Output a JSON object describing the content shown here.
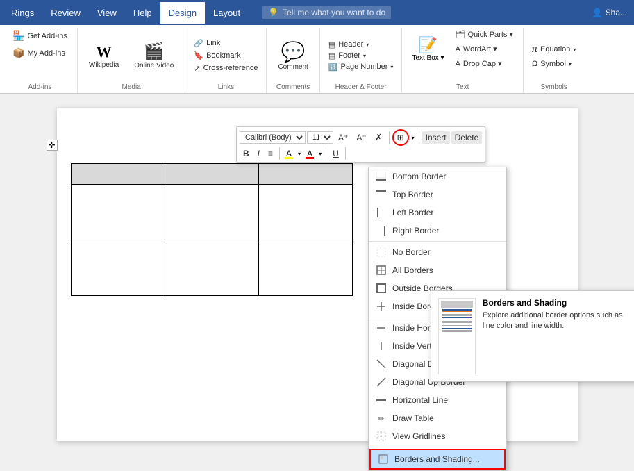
{
  "ribbon": {
    "tabs": [
      "Rings",
      "Review",
      "View",
      "Help",
      "Design",
      "Layout"
    ],
    "active_tab": "Design",
    "search_placeholder": "Tell me what you want to do",
    "user_label": "Sha...",
    "groups": {
      "addins": {
        "label": "Add-ins",
        "get_addins": "Get Add-ins",
        "my_addins": "My Add-ins"
      },
      "media": {
        "label": "Media",
        "wikipedia": "Wikipedia",
        "online_video": "Online Video"
      },
      "links": {
        "label": "Links",
        "link": "Link",
        "bookmark": "Bookmark",
        "cross_reference": "Cross-reference"
      },
      "comments": {
        "label": "Comments",
        "comment": "Comment"
      },
      "header_footer": {
        "label": "Header & Footer",
        "header": "Header",
        "footer": "Footer",
        "page_number": "Page Number"
      },
      "text": {
        "label": "Text",
        "text_box": "Text Box",
        "text_box_dropdown": "▾"
      },
      "symbols": {
        "label": "Symbols",
        "equation": "Equation",
        "symbol": "Symbol"
      }
    }
  },
  "mini_toolbar": {
    "font": "Calibri (Body)",
    "size": "11",
    "grow_icon": "A+",
    "shrink_icon": "A-",
    "clear_icon": "✗",
    "bold": "B",
    "italic": "I",
    "align": "≡",
    "highlight_color": "yellow",
    "font_color": "red",
    "underline": "U",
    "insert_label": "Insert",
    "delete_label": "Delete"
  },
  "dropdown_menu": {
    "items": [
      {
        "id": "bottom-border",
        "label": "Bottom Border",
        "icon": "bottom"
      },
      {
        "id": "top-border",
        "label": "Top Border",
        "icon": "top"
      },
      {
        "id": "left-border",
        "label": "Left Border",
        "icon": "left"
      },
      {
        "id": "right-border",
        "label": "Right Border",
        "icon": "right"
      },
      {
        "id": "no-border",
        "label": "No Border",
        "icon": "none"
      },
      {
        "id": "all-borders",
        "label": "All Borders",
        "icon": "all"
      },
      {
        "id": "outside-borders",
        "label": "Outside Borders",
        "icon": "outside"
      },
      {
        "id": "inside-borders",
        "label": "Inside Borders",
        "icon": "inside"
      },
      {
        "id": "inside-horiz",
        "label": "Inside Horizontal Border",
        "icon": "insideH"
      },
      {
        "id": "inside-vert",
        "label": "Inside Vertical Border",
        "icon": "insideV"
      },
      {
        "id": "diagonal-down",
        "label": "Diagonal Down Border",
        "icon": "diagDown"
      },
      {
        "id": "diagonal-up",
        "label": "Diagonal Up Border",
        "icon": "diagUp"
      },
      {
        "id": "horizontal",
        "label": "Horizontal Line",
        "icon": "horiz"
      },
      {
        "id": "draw-table",
        "label": "Draw Table",
        "icon": "draw"
      },
      {
        "id": "view-gridlines",
        "label": "View Gridlines",
        "icon": "grid"
      },
      {
        "id": "borders-shading",
        "label": "Borders and Shading...",
        "icon": "shading",
        "highlighted": true
      }
    ]
  },
  "border_tooltip": {
    "title": "Borders and Shading",
    "description": "Explore additional border options such as line color and line width."
  },
  "table": {
    "rows": 3,
    "cols": 3
  },
  "text_box_label": "Text Box ▾"
}
